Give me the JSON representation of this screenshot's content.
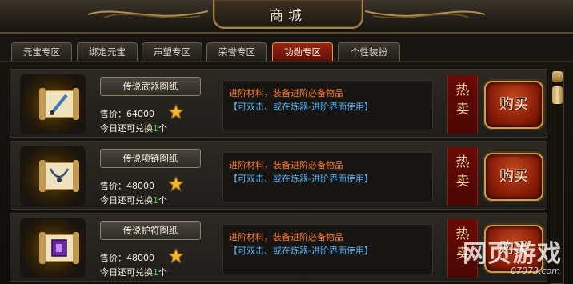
{
  "window": {
    "title": "商城"
  },
  "tabs": [
    {
      "label": "元宝专区"
    },
    {
      "label": "绑定元宝"
    },
    {
      "label": "声望专区"
    },
    {
      "label": "荣誉专区"
    },
    {
      "label": "功勋专区",
      "active": true
    },
    {
      "label": "个性装扮"
    }
  ],
  "items": [
    {
      "name": "传说武器图纸",
      "price": "售价：64000",
      "today_prefix": "今日还可兑换",
      "today_count": "1",
      "today_suffix": "个",
      "desc_line1": "进阶材料，装备进阶必备物品",
      "desc_line2": "【可双击、或在炼器-进阶界面使用】",
      "hot_line1": "热",
      "hot_line2": "卖",
      "buy_label": "购买",
      "icon": "weapon-scroll-icon"
    },
    {
      "name": "传说项链图纸",
      "price": "售价：48000",
      "today_prefix": "今日还可兑换",
      "today_count": "1",
      "today_suffix": "个",
      "desc_line1": "进阶材料，装备进阶必备物品",
      "desc_line2": "【可双击、或在炼器-进阶界面使用】",
      "hot_line1": "热",
      "hot_line2": "卖",
      "buy_label": "购买",
      "icon": "necklace-scroll-icon"
    },
    {
      "name": "传说护符图纸",
      "price": "售价：48000",
      "today_prefix": "今日还可兑换",
      "today_count": "1",
      "today_suffix": "个",
      "desc_line1": "进阶材料，装备进阶必备物品",
      "desc_line2": "【可双击、或在炼器-进阶界面使用】",
      "hot_line1": "热",
      "hot_line2": "卖",
      "buy_label": "购买",
      "icon": "amulet-scroll-icon"
    }
  ],
  "watermark": {
    "text": "网页游戏",
    "site": "07073.com"
  },
  "colors": {
    "accent": "#8e1a10",
    "gold": "#c99c52",
    "desc_orange": "#ff7a2a",
    "desc_blue": "#58aef0",
    "count_green": "#3fd23f"
  }
}
